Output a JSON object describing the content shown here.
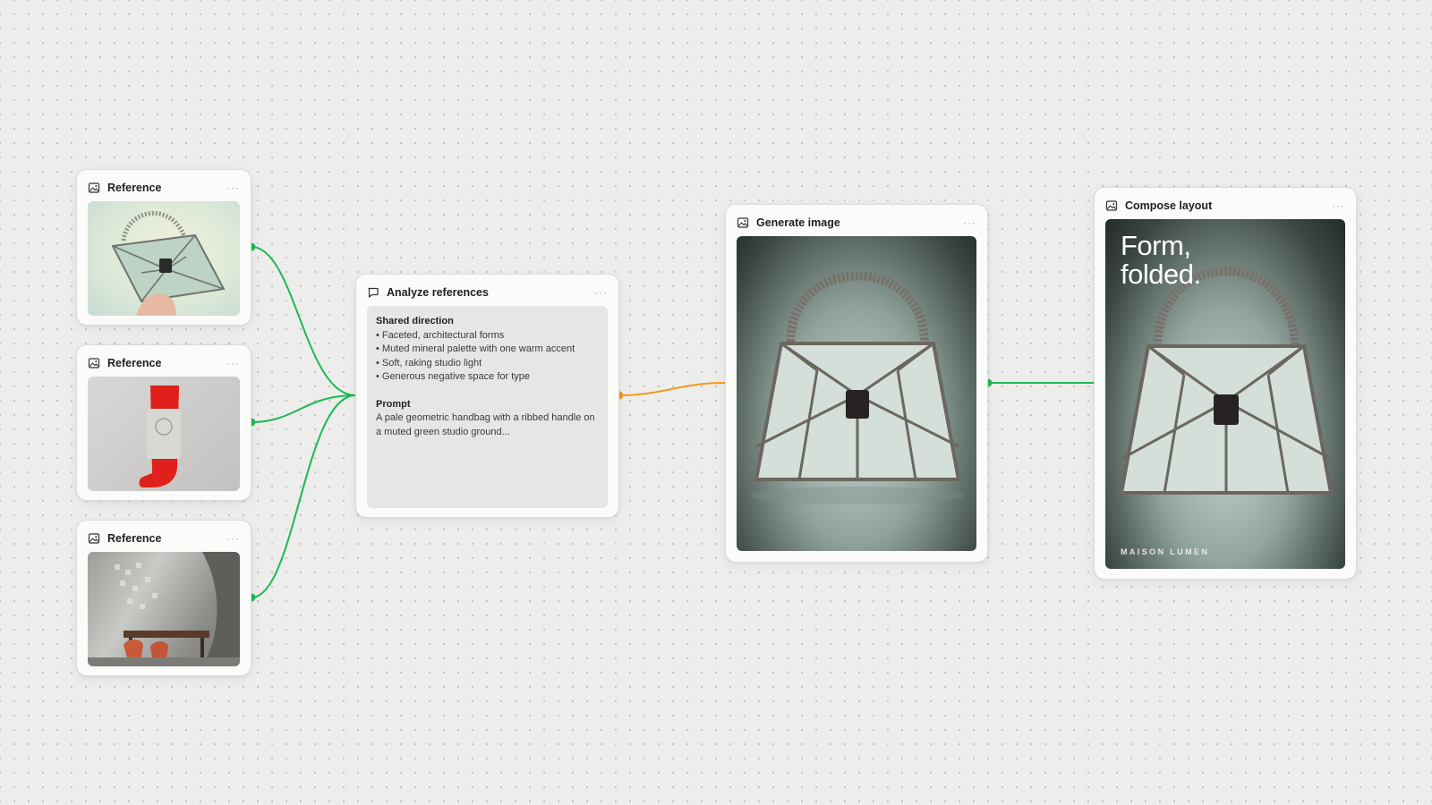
{
  "nodes": {
    "ref1": {
      "title": "Reference",
      "icon": "image-icon",
      "menu": "···"
    },
    "ref2": {
      "title": "Reference",
      "icon": "image-icon",
      "menu": "···"
    },
    "ref3": {
      "title": "Reference",
      "icon": "image-icon",
      "menu": "···"
    },
    "analyze": {
      "title": "Analyze references",
      "icon": "comment-icon",
      "menu": "···",
      "shared_heading": "Shared direction",
      "shared_items": [
        "Faceted, architectural forms",
        "Muted mineral palette with one warm accent",
        "Soft, raking studio light",
        "Generous negative space for type"
      ],
      "prompt_heading": "Prompt",
      "prompt_text": "A pale geometric handbag with a ribbed handle on a muted green studio ground..."
    },
    "generate": {
      "title": "Generate image",
      "icon": "image-icon",
      "menu": "···"
    },
    "compose": {
      "title": "Compose layout",
      "icon": "image-icon",
      "menu": "···",
      "poster_title": "Form,\nfolded.",
      "poster_brand": "MAISON LUMEN"
    }
  },
  "colors": {
    "wire_green": "#1db954",
    "wire_orange": "#f39a1e",
    "canvas": "#ededec"
  }
}
